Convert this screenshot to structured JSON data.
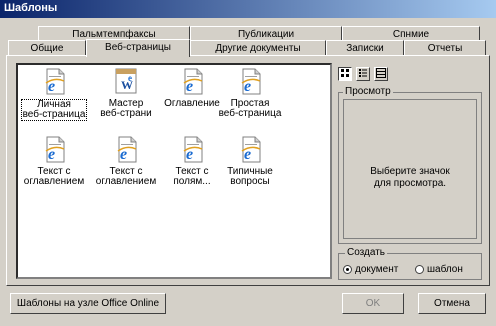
{
  "window": {
    "title": "Шаблоны"
  },
  "tabs_back": [
    {
      "label": "Пальмтемпфаксы"
    },
    {
      "label": "Публикации"
    },
    {
      "label": "Спнмие"
    }
  ],
  "tabs_front": [
    {
      "label": "Общие"
    },
    {
      "label": "Веб-страницы"
    },
    {
      "label": "Другие документы"
    },
    {
      "label": "Записки"
    },
    {
      "label": "Отчеты"
    }
  ],
  "templates": [
    {
      "line1": "Личная",
      "line2": "веб-страница",
      "icon": "web-page-icon",
      "selected": true
    },
    {
      "line1": "Мастер",
      "line2": "веб-страни",
      "icon": "wizard-icon",
      "selected": false
    },
    {
      "line1": "Оглавление",
      "line2": "",
      "icon": "web-page-icon",
      "selected": false
    },
    {
      "line1": "Простая",
      "line2": "веб-страница",
      "icon": "web-page-icon",
      "selected": false
    },
    {
      "line1": "Текст с",
      "line2": "оглавлением",
      "icon": "web-page-icon",
      "selected": false
    },
    {
      "line1": "Текст с",
      "line2": "оглавлением",
      "icon": "web-page-icon",
      "selected": false
    },
    {
      "line1": "Текст с",
      "line2": "полям...",
      "icon": "web-page-icon",
      "selected": false
    },
    {
      "line1": "Типичные",
      "line2": "вопросы",
      "icon": "web-page-icon",
      "selected": false
    }
  ],
  "view_buttons": [
    {
      "icon": "large-icons-view-icon",
      "active": true
    },
    {
      "icon": "list-view-icon",
      "active": false
    },
    {
      "icon": "details-view-icon",
      "active": false
    }
  ],
  "preview": {
    "legend": "Просмотр",
    "message_line1": "Выберите значок",
    "message_line2": "для просмотра."
  },
  "create": {
    "legend": "Создать",
    "option_document": "документ",
    "option_template": "шаблон",
    "selected": "document"
  },
  "buttons": {
    "office_online": "Шаблоны на узле Office Online",
    "ok": "OK",
    "cancel": "Отмена"
  },
  "colors": {
    "titlebar_start": "#0a246a",
    "titlebar_end": "#a6caf0",
    "face": "#d4d0c8",
    "ie_blue": "#1a6bd1"
  }
}
